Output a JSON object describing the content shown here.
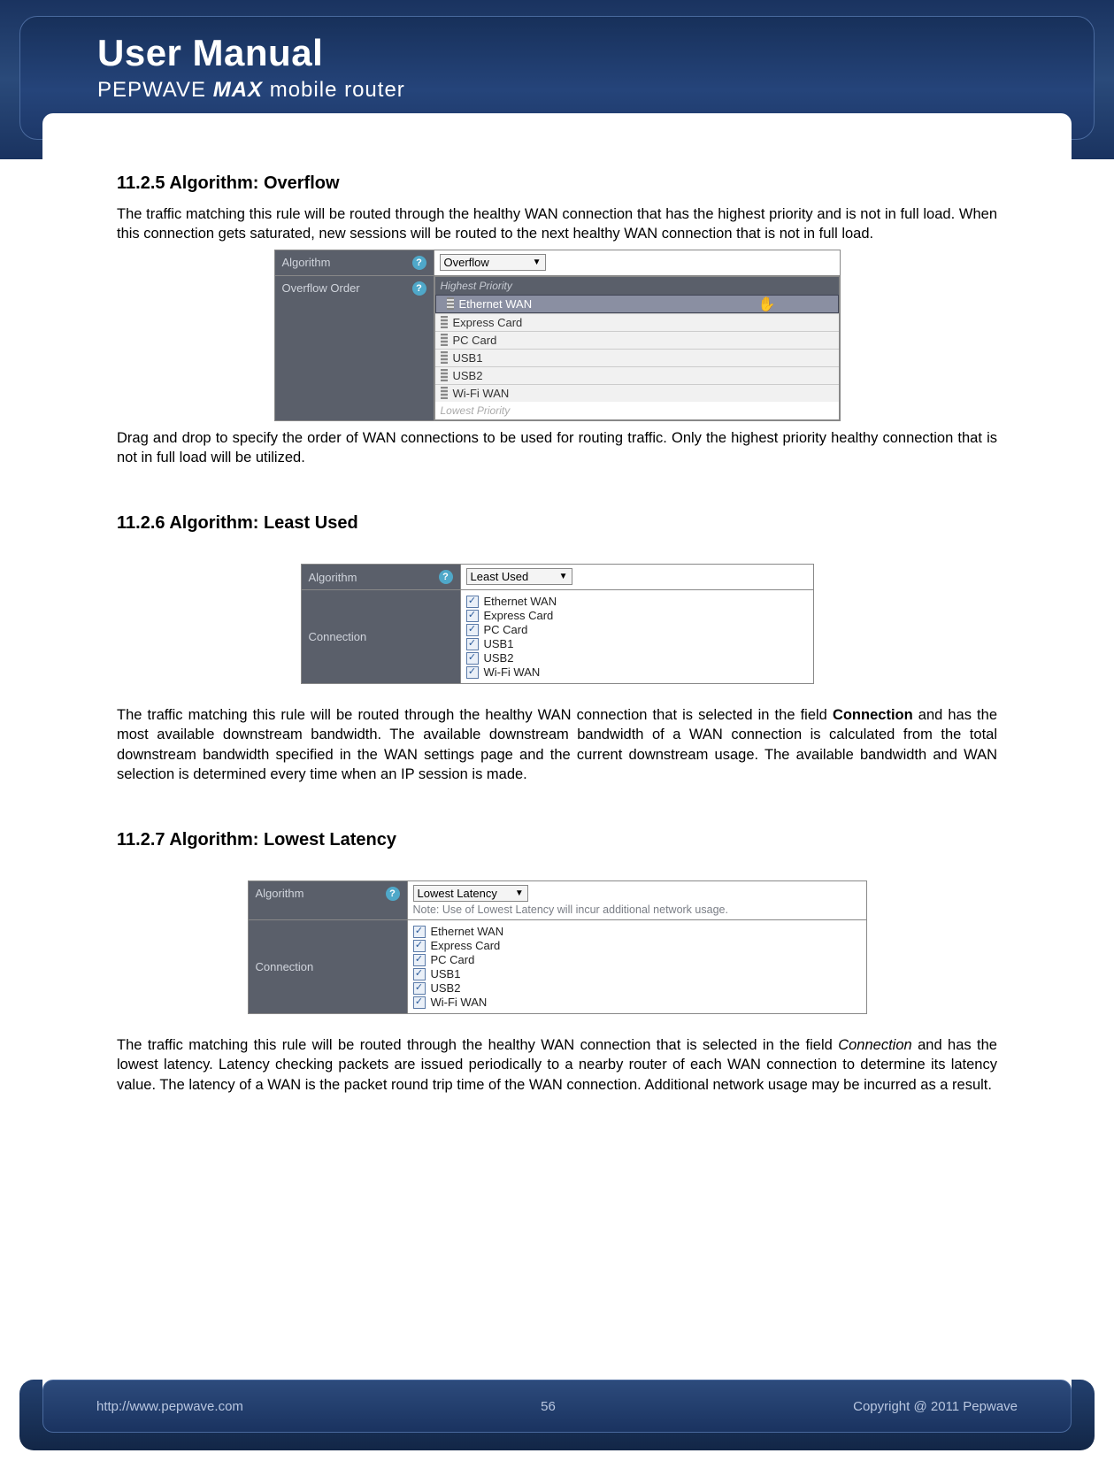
{
  "header": {
    "title": "User Manual",
    "brand": "PEPWAVE",
    "model": "MAX",
    "tagline": "mobile router"
  },
  "sections": {
    "overflow": {
      "heading": "11.2.5 Algorithm: Overflow",
      "intro": "The traffic matching this rule will be routed through the healthy WAN connection that has the highest priority and is not in full load. When this connection gets saturated, new sessions will be routed to the next healthy WAN connection that is not in full load.",
      "after": "Drag and drop to specify the order of WAN connections to be used for routing traffic. Only the highest priority healthy connection that is not in full load will be utilized.",
      "labels": {
        "algorithm": "Algorithm",
        "order": "Overflow Order"
      },
      "algorithm_value": "Overflow",
      "priority_top": "Highest Priority",
      "priority_bottom": "Lowest Priority",
      "items": [
        "Ethernet WAN",
        "Express Card",
        "PC Card",
        "USB1",
        "USB2",
        "Wi-Fi WAN"
      ]
    },
    "leastused": {
      "heading": "11.2.6 Algorithm: Least Used",
      "labels": {
        "algorithm": "Algorithm",
        "connection": "Connection"
      },
      "algorithm_value": "Least Used",
      "items": [
        "Ethernet WAN",
        "Express Card",
        "PC Card",
        "USB1",
        "USB2",
        "Wi-Fi WAN"
      ],
      "after_pre": "The traffic matching this rule will be routed through the healthy WAN connection that is selected in the field ",
      "conn_word": "Connection",
      "after_post": " and has the most available downstream bandwidth. The available downstream bandwidth of a WAN connection is calculated from the total downstream bandwidth specified in the WAN settings page and the current downstream usage. The available bandwidth and WAN selection is determined every time when an IP session is made."
    },
    "lowestlatency": {
      "heading": "11.2.7 Algorithm: Lowest Latency",
      "labels": {
        "algorithm": "Algorithm",
        "connection": "Connection"
      },
      "algorithm_value": "Lowest Latency",
      "note": "Note: Use of Lowest Latency will incur additional network usage.",
      "items": [
        "Ethernet WAN",
        "Express Card",
        "PC Card",
        "USB1",
        "USB2",
        "Wi-Fi WAN"
      ],
      "after_pre": "The traffic matching this rule will be routed through the healthy WAN connection that is selected in the field ",
      "conn_word": "Connection",
      "after_post": " and has the lowest latency.  Latency checking packets are issued periodically to a nearby router of each WAN connection to determine its latency value.  The latency of a WAN is the packet round trip time of the WAN connection.  Additional network usage may be incurred as a result."
    }
  },
  "footer": {
    "url": "http://www.pepwave.com",
    "page": "56",
    "copyright": "Copyright @ 2011 Pepwave"
  }
}
